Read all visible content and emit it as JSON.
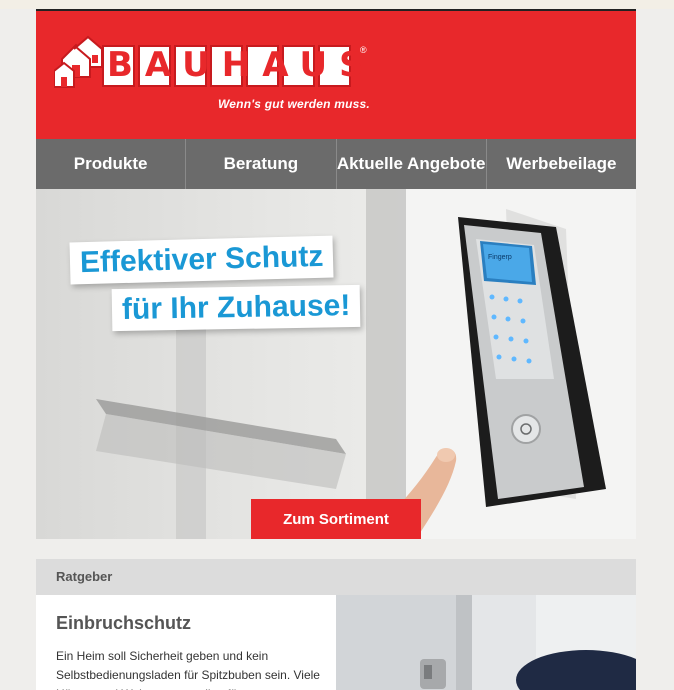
{
  "brand": {
    "name": "BAUHAUS",
    "registered": "®",
    "tagline": "Wenn's gut werden muss.",
    "colors": {
      "red": "#e8282b",
      "nav": "#6b6b6b",
      "headline": "#1a98d5"
    }
  },
  "nav": {
    "items": [
      {
        "label": "Produkte"
      },
      {
        "label": "Beratung"
      },
      {
        "label": "Aktuelle Angebote"
      },
      {
        "label": "Werbebeilage"
      }
    ]
  },
  "hero": {
    "headline_line1": "Effektiver Schutz",
    "headline_line2": "für Ihr Zuhause!",
    "cta_label": "Zum Sortiment",
    "device_screen_text": "Fingerp"
  },
  "section": {
    "label": "Ratgeber",
    "article_title": "Einbruchschutz",
    "article_body": "Ein Heim soll Sicherheit geben und kein Selbstbedienungsladen für Spitzbuben sein. Viele Häuser und Wohnungen stellen für"
  }
}
